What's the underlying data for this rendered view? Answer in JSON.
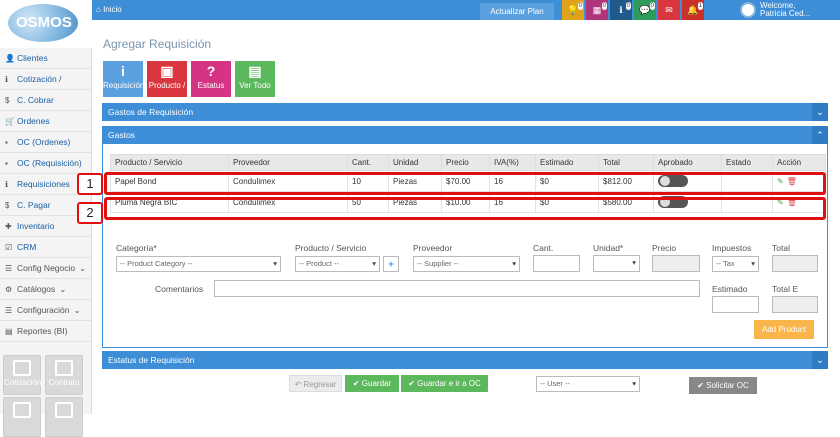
{
  "header": {
    "logo_text": "OSMOS",
    "home_label": "Inicio",
    "plan_button": "Actualizar Plan",
    "badges": [
      "0",
      "0",
      "0",
      "0",
      "",
      "1"
    ],
    "welcome_line1": "Welcome,",
    "welcome_line2": "Patricia Ced..."
  },
  "sidebar": {
    "items": [
      {
        "label": "Clientes"
      },
      {
        "label": "Cotización /"
      },
      {
        "label": "C. Cobrar"
      },
      {
        "label": "Ordenes"
      },
      {
        "label": "OC (Ordenes)"
      },
      {
        "label": "OC (Requisición)"
      },
      {
        "label": "Requisiciones"
      },
      {
        "label": "C. Pagar"
      },
      {
        "label": "Inventario"
      },
      {
        "label": "CRM"
      },
      {
        "label": "Config Negocio"
      },
      {
        "label": "Catálogos"
      },
      {
        "label": "Configuración"
      },
      {
        "label": "Reportes (BI)"
      }
    ],
    "tiles": [
      "Cotización",
      "Contrato"
    ]
  },
  "page": {
    "title": "Agregar Requisición",
    "buttons": [
      "Requisición",
      "Producto /",
      "Estatus",
      "Ver Todo"
    ],
    "panel_gastos_req": "Gastos de Requisición",
    "panel_gastos": "Gastos",
    "panel_estatus": "Estatus de Requisición"
  },
  "table": {
    "headers": [
      "Producto / Servicio",
      "Proveedor",
      "Cant.",
      "Unidad",
      "Precio",
      "IVA(%)",
      "Estimado",
      "Total",
      "Aprobado",
      "Estado",
      "Acción"
    ],
    "rows": [
      [
        "Papel Bond",
        "Condulimex",
        "10",
        "Piezas",
        "$70.00",
        "16",
        "$0",
        "$812.00"
      ],
      [
        "Pluma Negra BIC",
        "Condulimex",
        "50",
        "Piezas",
        "$10.00",
        "16",
        "$0",
        "$580.00"
      ]
    ]
  },
  "annotations": [
    "1",
    "2"
  ],
  "form": {
    "categoria_label": "Categoría*",
    "categoria_value": "-- Product Category --",
    "producto_label": "Producto / Servicio",
    "producto_value": "-- Product --",
    "proveedor_label": "Proveedor",
    "proveedor_value": "-- Supplier --",
    "cant_label": "Cant.",
    "unidad_label": "Unidad*",
    "precio_label": "Precio",
    "impuestos_label": "Impuestos",
    "impuestos_value": "-- Tax",
    "total_label": "Total",
    "comentarios_label": "Comentarios",
    "estimado_label": "Estimado",
    "total2_label": "Total E",
    "add_product": "Add Product"
  },
  "footer": {
    "regresar": "Regresar",
    "guardar": "Guardar",
    "guardar_ir": "Guardar e ir a OC",
    "user_select": "-- User --",
    "solicitar": "Solicitar OC"
  },
  "colors": {
    "primary": "#3d8ed6",
    "highlight": "#e01010",
    "add": "#f9b44a",
    "save": "#5cb85c"
  }
}
